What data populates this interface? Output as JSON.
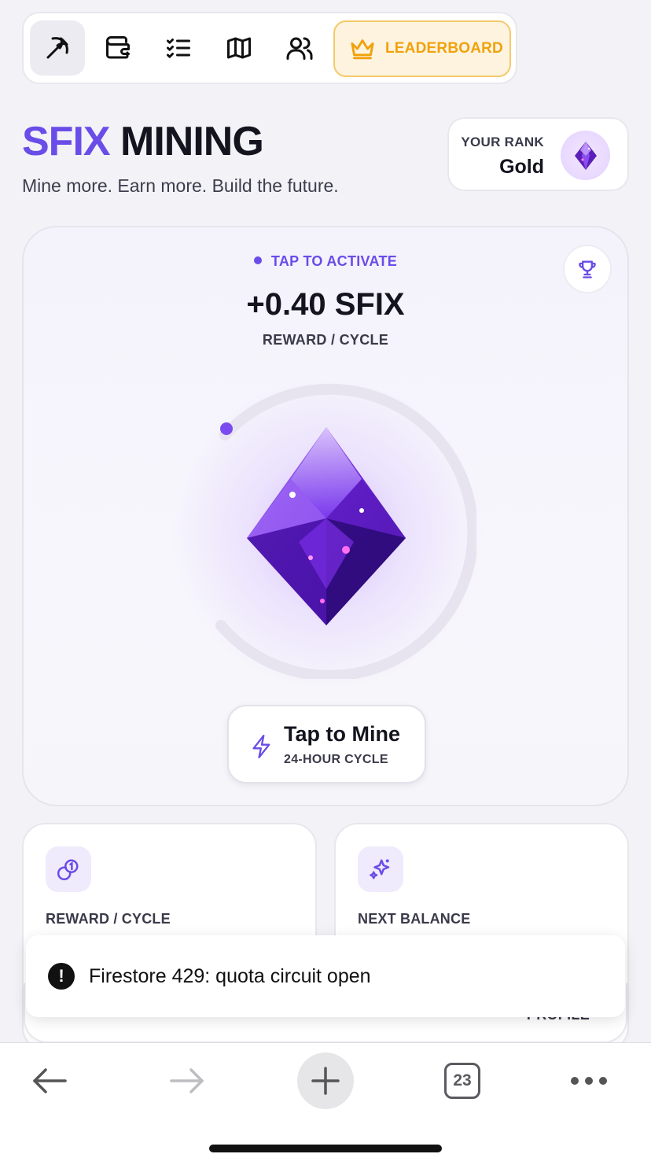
{
  "nav": {
    "icons": [
      "pickaxe-icon",
      "wallet-icon",
      "checklist-icon",
      "map-icon",
      "users-icon"
    ],
    "leaderboard_label": "LEADERBOARD"
  },
  "header": {
    "title_accent": "SFIX",
    "title_rest": "MINING",
    "subtitle": "Mine more. Earn more. Build the future."
  },
  "rank": {
    "label": "YOUR RANK",
    "value": "Gold"
  },
  "mining": {
    "status": "TAP TO ACTIVATE",
    "reward_amount": "+0.40 SFIX",
    "reward_label": "REWARD / CYCLE",
    "button_title": "Tap to Mine",
    "button_subtitle": "24-HOUR CYCLE"
  },
  "stats": {
    "reward_label": "REWARD / CYCLE",
    "next_balance_label": "NEXT BALANCE",
    "profile_label": "PROFILE"
  },
  "toast": {
    "message": "Firestore 429: quota circuit open"
  },
  "browser": {
    "tab_count": "23"
  },
  "colors": {
    "accent": "#6a4ce8",
    "leaderboard": "#f1a10a",
    "text": "#14141f"
  }
}
